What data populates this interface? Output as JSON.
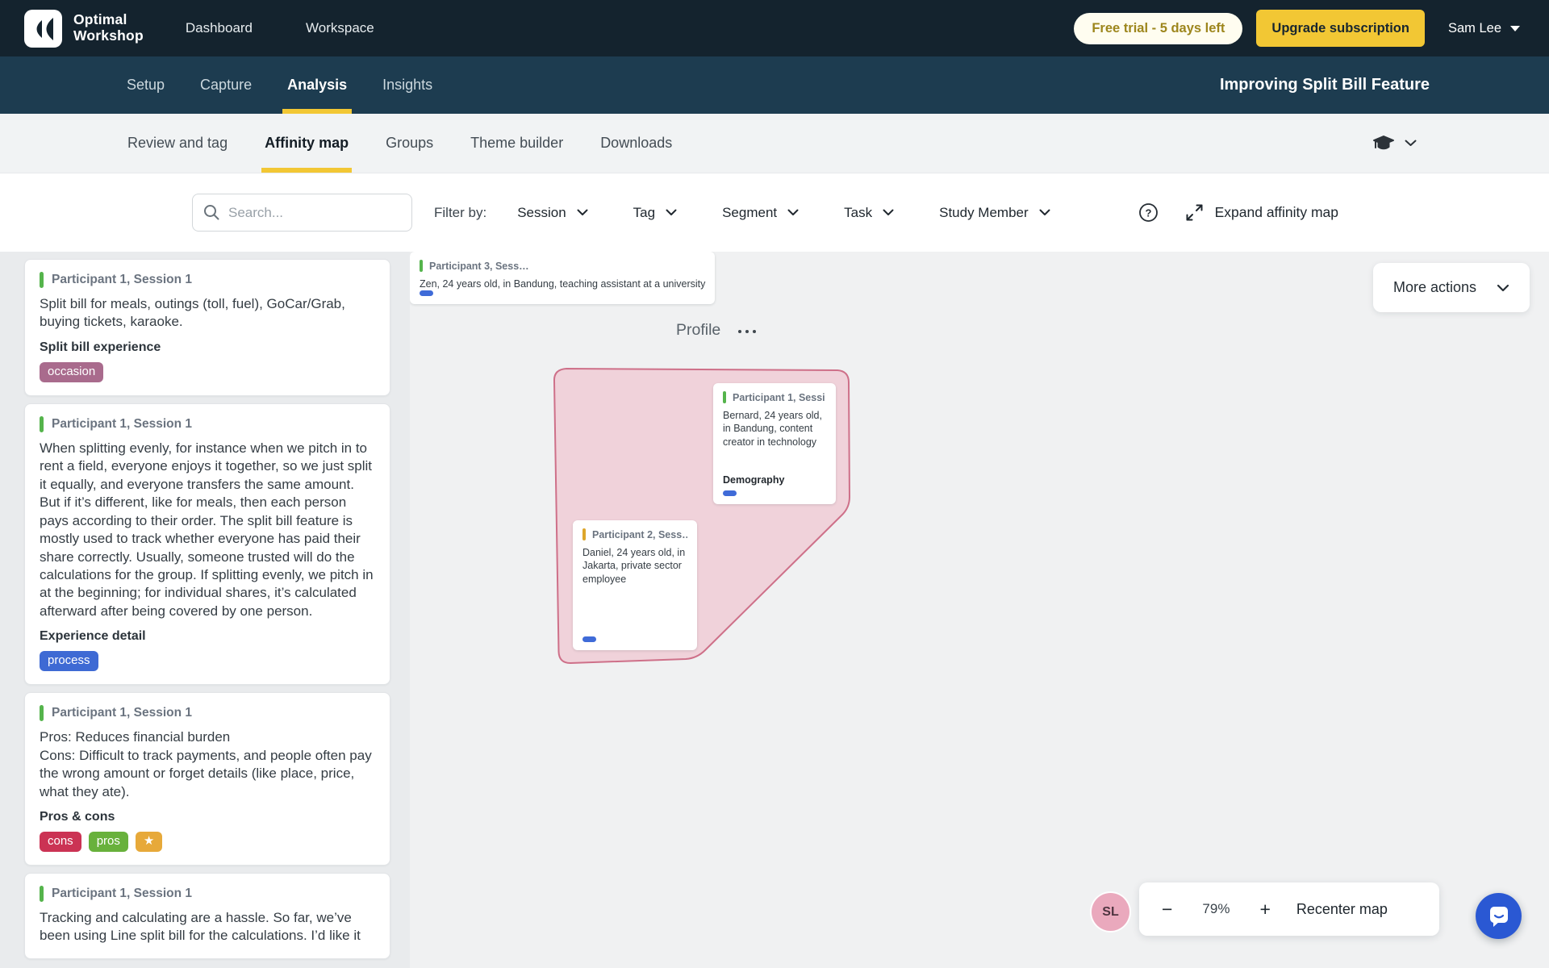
{
  "topbar": {
    "brand_line1": "Optimal",
    "brand_line2": "Workshop",
    "nav": [
      {
        "label": "Dashboard"
      },
      {
        "label": "Workspace"
      }
    ],
    "trial_badge": "Free trial - 5 days left",
    "upgrade_label": "Upgrade subscription",
    "user_name": "Sam Lee"
  },
  "study_nav": {
    "tabs": [
      {
        "label": "Setup",
        "active": false
      },
      {
        "label": "Capture",
        "active": false
      },
      {
        "label": "Analysis",
        "active": true
      },
      {
        "label": "Insights",
        "active": false
      }
    ],
    "study_title": "Improving Split Bill Feature"
  },
  "analysis_nav": {
    "tabs": [
      {
        "label": "Review and tag",
        "active": false
      },
      {
        "label": "Affinity map",
        "active": true
      },
      {
        "label": "Groups",
        "active": false
      },
      {
        "label": "Theme builder",
        "active": false
      },
      {
        "label": "Downloads",
        "active": false
      }
    ]
  },
  "filter_bar": {
    "search_placeholder": "Search...",
    "filter_by_label": "Filter by:",
    "filters": [
      {
        "label": "Session"
      },
      {
        "label": "Tag"
      },
      {
        "label": "Segment"
      },
      {
        "label": "Task"
      },
      {
        "label": "Study Member"
      }
    ],
    "expand_label": "Expand affinity map"
  },
  "notes_panel": {
    "cards": [
      {
        "header": "Participant 1, Session 1",
        "accent": "#55b44c",
        "body": "Split bill for meals, outings (toll, fuel), GoCar/Grab, buying tickets, karaoke.",
        "tag_group": "Split bill experience",
        "tags": [
          {
            "label": "occasion",
            "color": "#a96b8d"
          }
        ]
      },
      {
        "header": "Participant 1, Session 1",
        "accent": "#55b44c",
        "body": "When splitting evenly, for instance when we pitch in to rent a field, everyone enjoys it together, so we just split it equally, and everyone transfers the same amount. But if it’s different, like for meals, then each person pays according to their order. The split bill feature is mostly used to track whether everyone has paid their share correctly. Usually, someone trusted will do the calculations for the group. If splitting evenly, we pitch in at the beginning; for individual shares, it’s calculated afterward after being covered by one person.",
        "tag_group": "Experience detail",
        "tags": [
          {
            "label": "process",
            "color": "#3e6ad4"
          }
        ]
      },
      {
        "header": "Participant 1, Session 1",
        "accent": "#55b44c",
        "body": "Pros: Reduces financial burden\nCons: Difficult to track payments, and people often pay the wrong amount or forget details (like place, price, what they ate).",
        "tag_group": "Pros & cons",
        "tags": [
          {
            "label": "cons",
            "color": "#cb3354"
          },
          {
            "label": "pros",
            "color": "#68b13c"
          },
          {
            "label": "★",
            "color": "#e7a93a"
          }
        ]
      },
      {
        "header": "Participant 1, Session 1",
        "accent": "#55b44c",
        "body": "Tracking and calculating are a hassle. So far, we’ve been using Line split bill for the calculations. I’d like it",
        "tag_group": "",
        "tags": []
      }
    ]
  },
  "canvas": {
    "more_actions_label": "More actions",
    "group": {
      "title": "Profile",
      "cards": [
        {
          "header": "Participant 1, Sessi…",
          "accent": "#55b44c",
          "body": "Bernard, 24 years old, in Bandung, content creator in technology",
          "label": "Demography"
        },
        {
          "header": "Participant 2, Sess…",
          "accent": "#dda62c",
          "body": "Daniel, 24 years old, in Jakarta, private sector employee",
          "label": ""
        },
        {
          "header": "Participant 3, Sess…",
          "accent": "#55b44c",
          "body": "Zen, 24 years old, in Bandung, teaching assistant at a university",
          "label": ""
        }
      ]
    },
    "zoom": {
      "minus": "−",
      "level": "79%",
      "plus": "+",
      "recenter_label": "Recenter map"
    },
    "avatar_initials": "SL"
  },
  "colors": {
    "accent_yellow": "#f2c734",
    "topbar_bg": "#14232e",
    "studybar_bg": "#1d3c50",
    "blob_fill": "#f0d2da",
    "blob_stroke": "#ce7089",
    "mini_tag_blue": "#3f6bd8"
  }
}
